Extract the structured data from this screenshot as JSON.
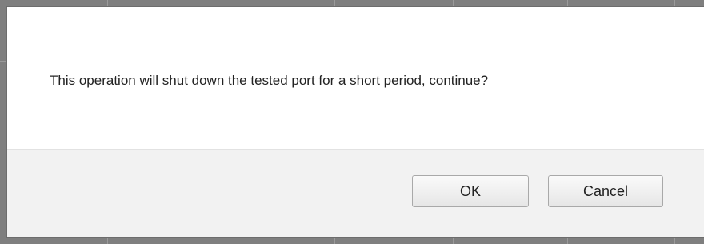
{
  "dialog": {
    "message": "This operation will shut down the tested port for a short period, continue?",
    "buttons": {
      "ok_label": "OK",
      "cancel_label": "Cancel"
    }
  },
  "colors": {
    "backdrop": "#7f7f7f",
    "dialog_background": "#ffffff",
    "button_bar_background": "#f2f2f2",
    "text": "#222222"
  }
}
